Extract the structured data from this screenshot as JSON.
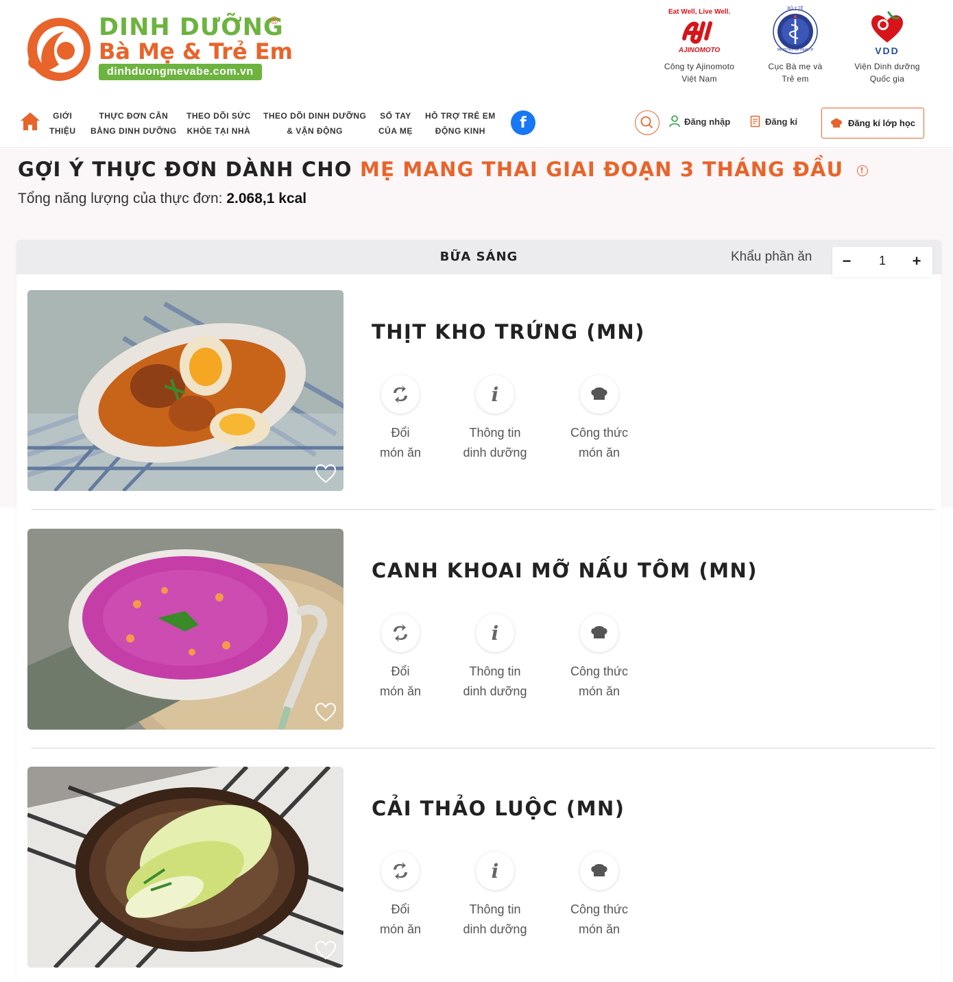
{
  "brand": {
    "line1": "DINH DƯỠNG",
    "reg": "®",
    "line2": "Bà Mẹ & Trẻ Em",
    "url": "dinhduongmevabe.com.vn"
  },
  "partners": [
    {
      "tagline": "Eat Well, Live Well.",
      "wordmark": "AJINOMOTO",
      "name_line1": "Công ty Ajinomoto",
      "name_line2": "Việt Nam",
      "icon": "ajinomoto-logo"
    },
    {
      "seal_top": "BỘ Y TẾ",
      "seal_bottom": "MINISTRY OF HEALTH",
      "name_line1": "Cục Bà mẹ và",
      "name_line2": "Trẻ em",
      "icon": "ministry-of-health-logo"
    },
    {
      "wordmark": "VDD",
      "name_line1": "Viện Dinh dưỡng",
      "name_line2": "Quốc gia",
      "icon": "vdd-logo"
    }
  ],
  "nav": {
    "items": [
      {
        "line1": "GIỚI",
        "line2": "THIỆU"
      },
      {
        "line1": "THỰC ĐƠN CÂN",
        "line2": "BẰNG DINH DƯỠNG"
      },
      {
        "line1": "THEO DÕI SỨC",
        "line2": "KHỎE TẠI NHÀ"
      },
      {
        "line1": "THEO DÕI DINH DƯỠNG",
        "line2": "& VẬN ĐỘNG"
      },
      {
        "line1": "SỔ TAY",
        "line2": "CỦA MẸ"
      },
      {
        "line1": "HỖ TRỢ TRẺ EM",
        "line2": "ĐỘNG KINH"
      }
    ],
    "facebook_glyph": "f",
    "login": "Đăng nhập",
    "register": "Đăng kí",
    "class_register": "Đăng kí lớp học"
  },
  "page": {
    "title_prefix": "GỢI Ý THỰC ĐƠN DÀNH CHO",
    "title_highlight": "MẸ MANG THAI GIAI ĐOẠN 3 THÁNG ĐẦU",
    "info_glyph": "!",
    "energy_label": "Tổng năng lượng của thực đơn:",
    "energy_value": "2.068,1 kcal"
  },
  "meal": {
    "name": "BỮA SÁNG",
    "serving_label": "Khẩu phần ăn",
    "minus": "−",
    "plus": "+",
    "serving_value": "1",
    "actions": {
      "swap_line1": "Đổi",
      "swap_line2": "món ăn",
      "info_line1": "Thông tin",
      "info_line2": "dinh dưỡng",
      "recipe_line1": "Công thức",
      "recipe_line2": "món ăn",
      "info_glyph": "i"
    },
    "dishes": [
      {
        "name": "THỊT KHO TRỨNG (MN)",
        "photo": "braised-pork-with-eggs"
      },
      {
        "name": "CANH KHOAI MỠ NẤU TÔM (MN)",
        "photo": "purple-yam-shrimp-soup"
      },
      {
        "name": "CẢI THẢO LUỘC (MN)",
        "photo": "boiled-napa-cabbage"
      }
    ]
  },
  "colors": {
    "brand_orange": "#e8642b",
    "brand_green": "#6cb33f",
    "facebook_blue": "#1877f2"
  }
}
